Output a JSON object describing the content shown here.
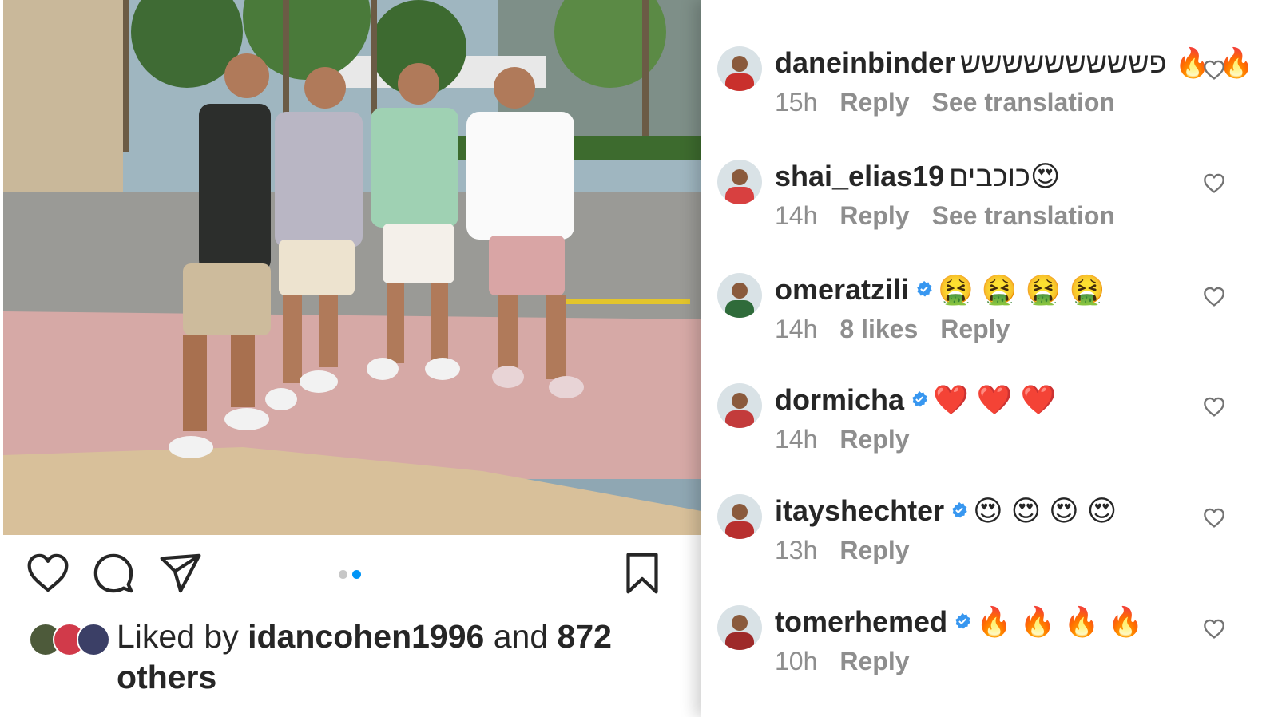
{
  "post": {
    "likes": {
      "prefix": "Liked by ",
      "user": "idancohen1996",
      "middle": " and ",
      "count": "872",
      "suffix": "others"
    },
    "carousel": {
      "total": 2,
      "active": 2
    },
    "icons": {
      "like": "heart-icon",
      "comment": "comment-icon",
      "share": "send-icon",
      "save": "bookmark-icon"
    }
  },
  "comments": [
    {
      "username": "daneinbinder",
      "verified": false,
      "text": "פששששששששש 🔥 🔥",
      "time": "15h",
      "likes": "",
      "reply": "Reply",
      "translate": "See translation"
    },
    {
      "username": "shai_elias19",
      "verified": false,
      "text": "כוכבים😍",
      "time": "14h",
      "likes": "",
      "reply": "Reply",
      "translate": "See translation"
    },
    {
      "username": "omeratzili",
      "verified": true,
      "text": "🤮 🤮 🤮 🤮",
      "time": "14h",
      "likes": "8 likes",
      "reply": "Reply",
      "translate": ""
    },
    {
      "username": "dormicha",
      "verified": true,
      "text": "❤️ ❤️ ❤️",
      "time": "14h",
      "likes": "",
      "reply": "Reply",
      "translate": ""
    },
    {
      "username": "itayshechter",
      "verified": true,
      "text": "😍 😍 😍 😍",
      "time": "13h",
      "likes": "",
      "reply": "Reply",
      "translate": ""
    },
    {
      "username": "tomerhemed",
      "verified": true,
      "text": "🔥 🔥 🔥 🔥",
      "time": "10h",
      "likes": "",
      "reply": "Reply",
      "translate": ""
    }
  ],
  "colors": {
    "text": "#262626",
    "meta": "#8e8e8e",
    "verified": "#3897f0",
    "dot_active": "#0095f6",
    "dot_inactive": "#c7c7c7"
  }
}
